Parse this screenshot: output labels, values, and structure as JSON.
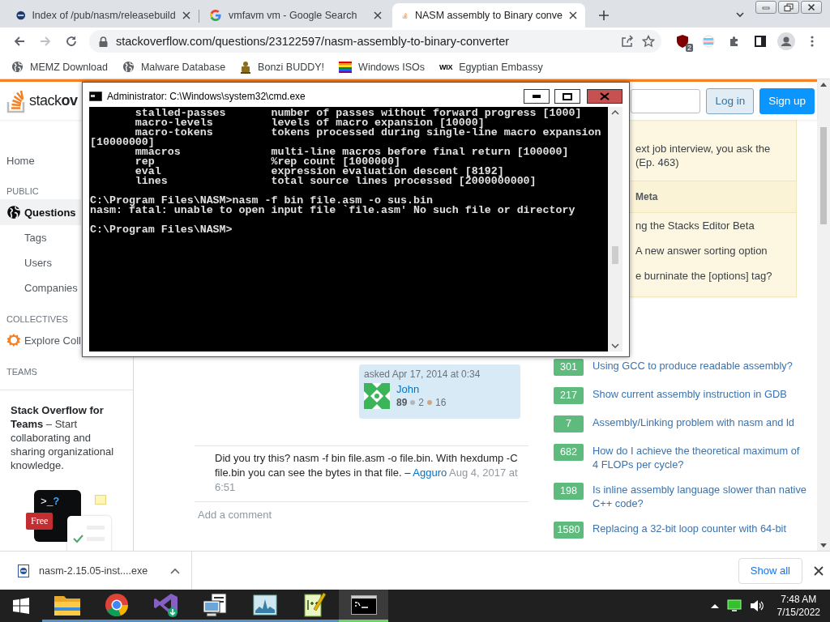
{
  "browser": {
    "tabs": [
      {
        "title": "Index of /pub/nasm/releasebuild",
        "selected": false
      },
      {
        "title": "vmfavm vm - Google Search",
        "selected": false
      },
      {
        "title": "NASM assembly to Binary conve",
        "selected": true
      }
    ],
    "address": "stackoverflow.com/questions/23122597/nasm-assembly-to-binary-converter",
    "extension_badge": "2",
    "bookmarks": [
      {
        "label": "MEMZ Download"
      },
      {
        "label": "Malware Database"
      },
      {
        "label": "Bonzi BUDDY!"
      },
      {
        "label": "Windows ISOs"
      },
      {
        "label": "Egyptian Embassy",
        "icon_text": "WIX"
      }
    ]
  },
  "site": {
    "logo": {
      "light": "stack",
      "bold": "ov"
    },
    "header_buttons": [
      {
        "label": "Log in",
        "kind": "secondary"
      },
      {
        "label": "Sign up",
        "kind": "primary"
      }
    ],
    "nav": [
      {
        "kind": "link",
        "label": "Home",
        "selected": false
      },
      {
        "kind": "heading",
        "label": "PUBLIC"
      },
      {
        "kind": "link",
        "label": "Questions",
        "selected": true
      },
      {
        "kind": "sublink",
        "label": "Tags",
        "selected": false
      },
      {
        "kind": "sublink",
        "label": "Users",
        "selected": false
      },
      {
        "kind": "sublink",
        "label": "Companies",
        "selected": false
      },
      {
        "kind": "heading",
        "label": "COLLECTIVES"
      },
      {
        "kind": "link",
        "label": "Explore Coll",
        "selected": false
      },
      {
        "kind": "heading",
        "label": "TEAMS"
      }
    ],
    "teams_card": {
      "text": "**Stack Overflow for Teams** – Start collaborating and sharing organizational knowledge.",
      "prompt": ">_",
      "prompt_mark": "?",
      "badge": "Free"
    },
    "signature": {
      "action": "asked Apr 17, 2014 at 0:34",
      "user": "John",
      "reputation": "89",
      "silver": "2",
      "bronze": "16"
    },
    "comment": {
      "text": "Did you try this? nasm -f bin file.asm -o file.bin. With hexdump -C file.bin you can see the bytes in that file. –",
      "author": "Agguro",
      "date": "Aug 4, 2017 at 6:51"
    },
    "add_comment": "Add a comment",
    "blog_widget": {
      "items": [
        {
          "lines": [
            "ext job interview, you ask the",
            "(Ep. 463)"
          ]
        }
      ],
      "meta_heading": "Meta",
      "meta_items": [
        "ng the Stacks Editor Beta",
        "A new answer sorting option",
        "e burninate the [options] tag?"
      ]
    },
    "related": [
      {
        "score": "301",
        "title": "Using GCC to produce readable assembly?"
      },
      {
        "score": "217",
        "title": "Show current assembly instruction in GDB"
      },
      {
        "score": "7",
        "title": "Assembly/Linking problem with nasm and ld"
      },
      {
        "score": "682",
        "title": "How do I achieve the theoretical maximum of 4 FLOPs per cycle?"
      },
      {
        "score": "198",
        "title": "Is inline assembly language slower than native C++ code?"
      },
      {
        "score": "1580",
        "title": "Replacing a 32-bit loop counter with 64-bit"
      }
    ]
  },
  "console": {
    "title": "Administrator: C:\\Windows\\system32\\cmd.exe",
    "blocks": [
      [
        "       stalled-passes       number of passes without forward progress [1000]",
        "       macro-levels         levels of macro expansion [10000]",
        "       macro-tokens         tokens processed during single-line macro expansion",
        "[10000000]",
        "       mmacros              multi-line macros before final return [100000]",
        "       rep                  %rep count [1000000]",
        "       eval                 expression evaluation descent [8192]",
        "       lines                total source lines processed [2000000000]"
      ],
      [
        "C:\\Program Files\\NASM>nasm -f bin file.asm -o sus.bin",
        "nasm: fatal: unable to open input file `file.asm' No such file or directory"
      ],
      [
        "C:\\Program Files\\NASM>"
      ]
    ]
  },
  "downloads": {
    "file": "nasm-2.15.05-inst....exe",
    "button": "Show all"
  },
  "taskbar": {
    "apps": [
      {
        "kind": "folder",
        "selected": false
      },
      {
        "kind": "chrome",
        "selected": false
      },
      {
        "kind": "visual-studio",
        "selected": false
      },
      {
        "kind": "network",
        "selected": false
      },
      {
        "kind": "image",
        "selected": false
      },
      {
        "kind": "notepad",
        "selected": false
      },
      {
        "kind": "console",
        "selected": true
      }
    ],
    "time": "7:48 AM",
    "date": "7/15/2022"
  }
}
